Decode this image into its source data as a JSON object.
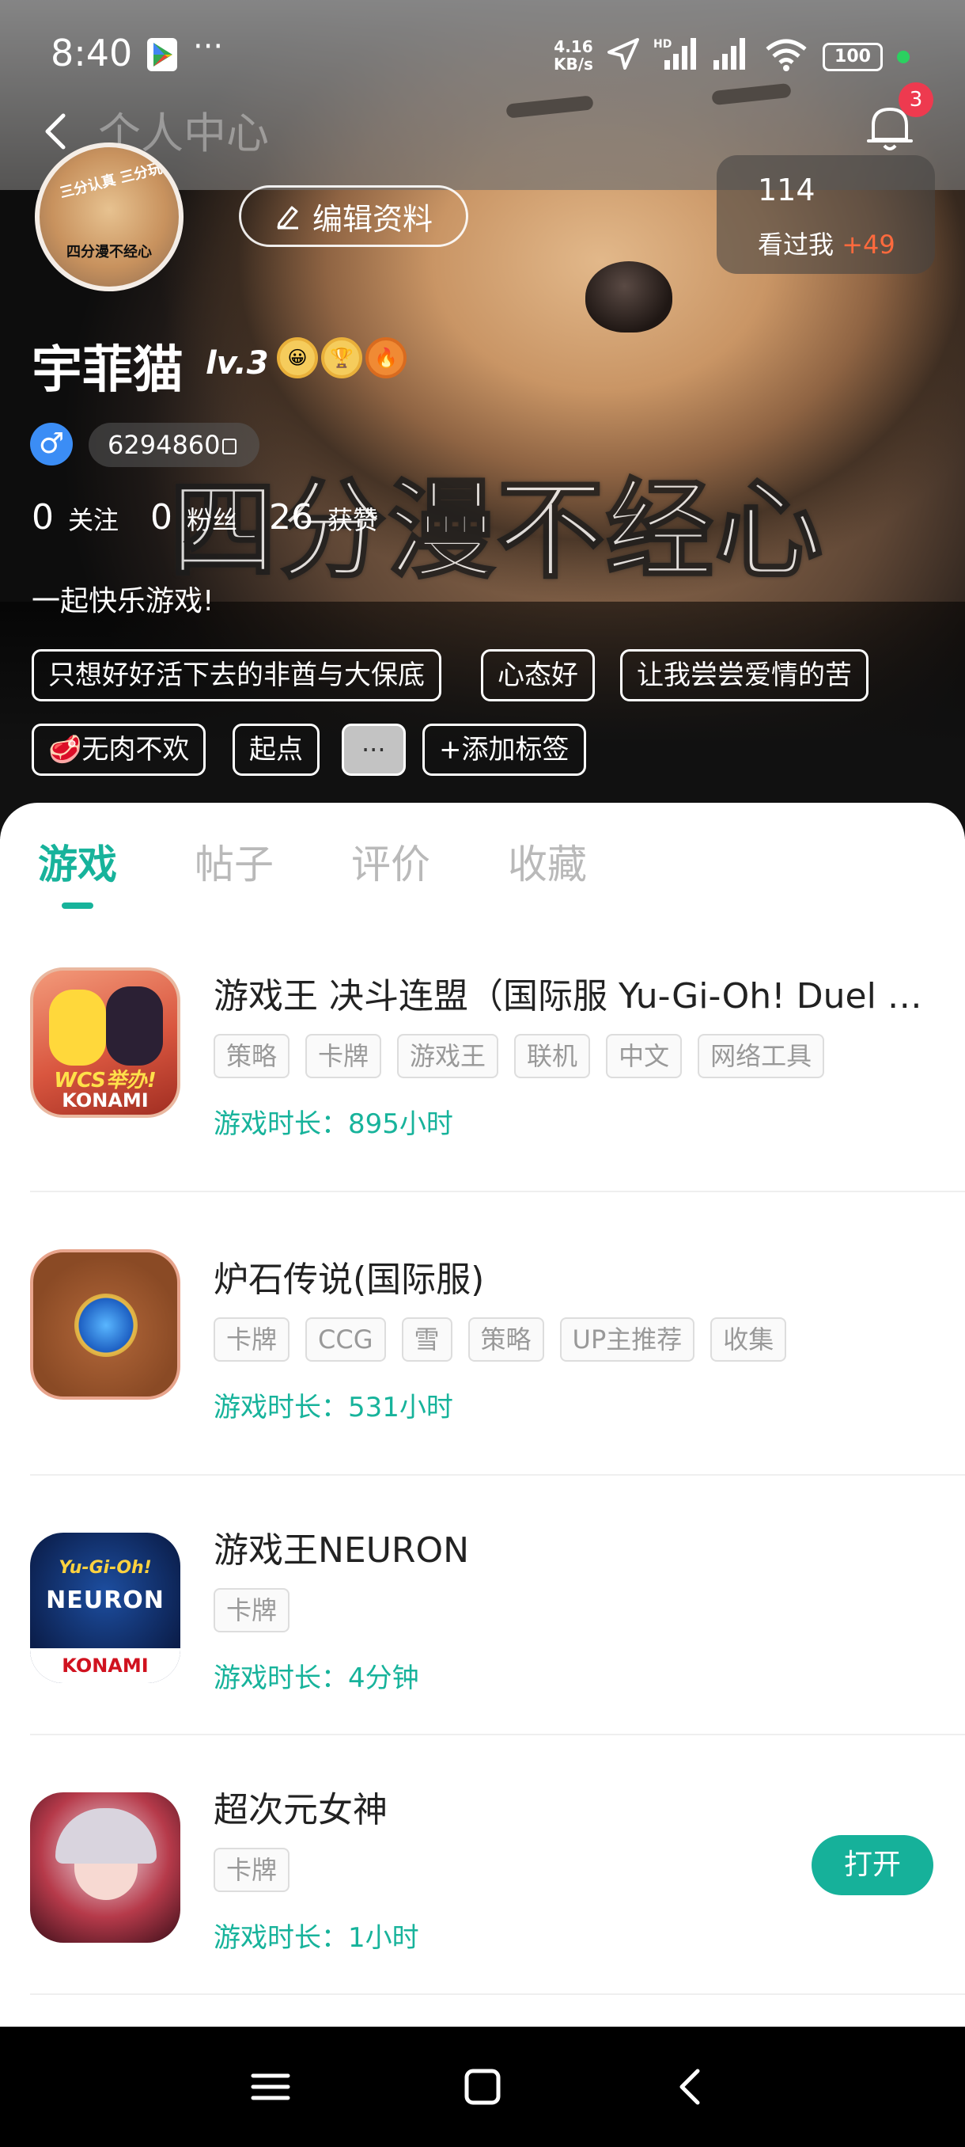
{
  "status_bar": {
    "time": "8:40",
    "more": "···",
    "speed_value": "4.16",
    "speed_unit": "KB/s",
    "hd": "HD",
    "battery": "100"
  },
  "header": {
    "title": "个人中心",
    "notification_count": "3"
  },
  "profile": {
    "avatar_text_top": "三分认真 三分玩",
    "avatar_text_bottom": "四分漫不经心",
    "edit_button": "编辑资料",
    "viewed_count": "114",
    "viewed_label": "看过我",
    "viewed_delta": "+49",
    "username": "宇菲猫",
    "level": "lv.3",
    "gender_symbol": "♂",
    "uid": "6294860",
    "stats": [
      {
        "value": "0",
        "label": "关注"
      },
      {
        "value": "0",
        "label": "粉丝"
      },
      {
        "value": "26",
        "label": "获赞"
      }
    ],
    "bio": "一起快乐游戏!",
    "background_caption": "四分漫不经心",
    "tags_row1": [
      "只想好好活下去的非酋与大保底",
      "心态好",
      "让我尝尝爱情的苦"
    ],
    "tags_row2": [
      "🥩无肉不欢",
      "起点",
      "···",
      "+添加标签"
    ]
  },
  "tabs": [
    "游戏",
    "帖子",
    "评价",
    "收藏"
  ],
  "games": [
    {
      "title": "游戏王 决斗连盟（国际服 Yu-Gi-Oh! Duel Links）",
      "tags": [
        "策略",
        "卡牌",
        "游戏王",
        "联机",
        "中文",
        "网络工具"
      ],
      "playtime": "游戏时长：895小时",
      "icon_text": "WCS举办!",
      "icon_brand": "KONAMI"
    },
    {
      "title": "炉石传说(国际服)",
      "tags": [
        "卡牌",
        "CCG",
        "雪",
        "策略",
        "UP主推荐",
        "收集"
      ],
      "playtime": "游戏时长：531小时"
    },
    {
      "title": "游戏王NEURON",
      "tags": [
        "卡牌"
      ],
      "playtime": "游戏时长：4分钟",
      "icon_text": "Yu-Gi-Oh!",
      "icon_sub": "NEURON",
      "icon_brand": "KONAMI"
    },
    {
      "title": "超次元女神",
      "tags": [
        "卡牌"
      ],
      "playtime": "游戏时长：1小时",
      "action": "打开"
    }
  ]
}
